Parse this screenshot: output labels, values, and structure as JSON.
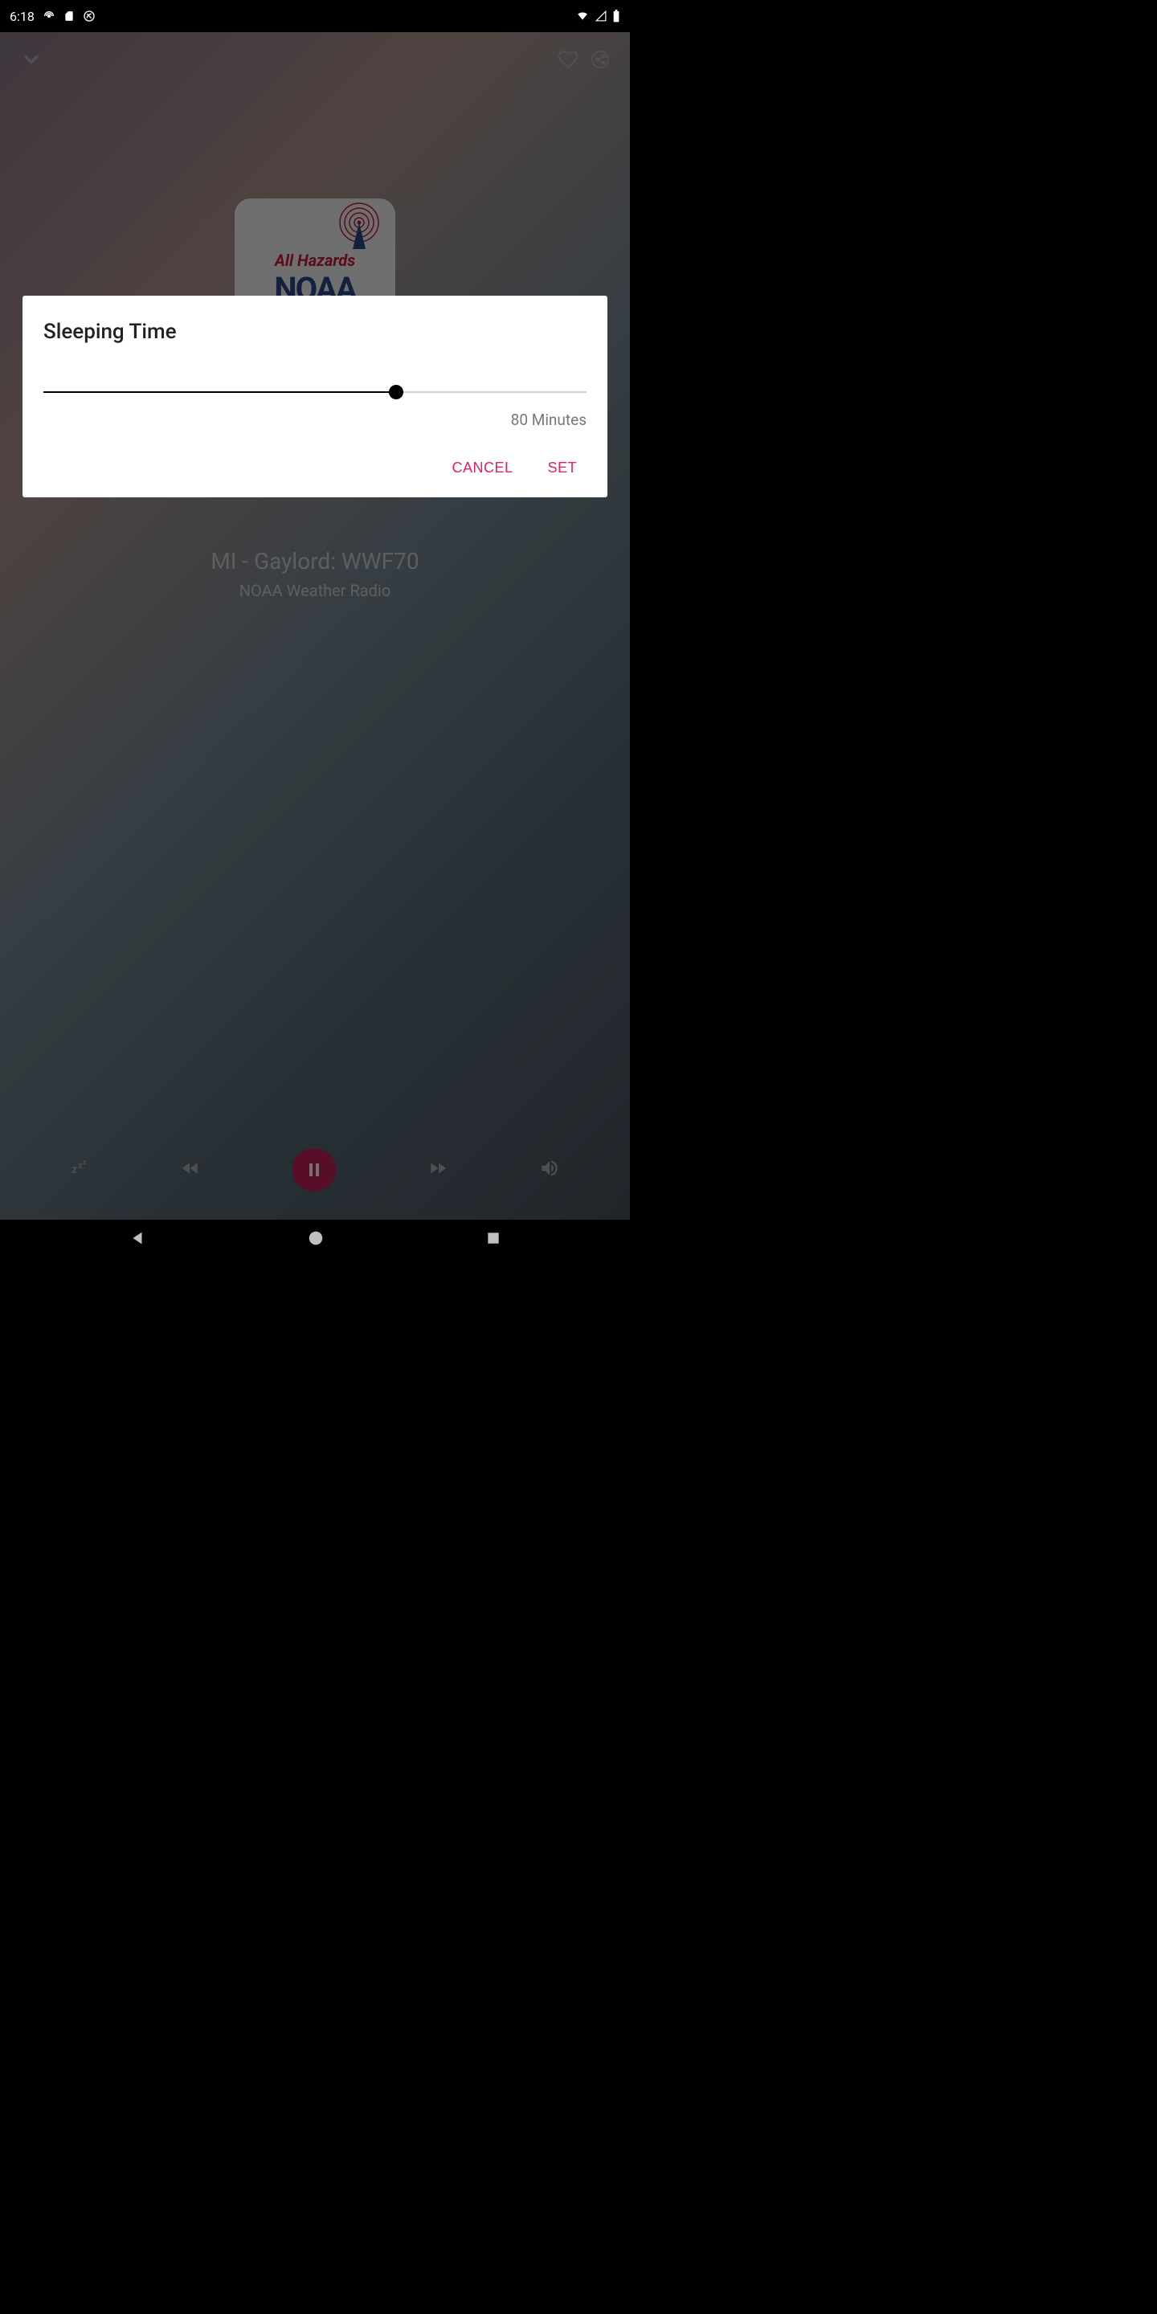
{
  "statusBar": {
    "time": "6:18"
  },
  "player": {
    "stationTitle": "MI - Gaylord: WWF70",
    "stationSubtitle": "NOAA Weather Radio",
    "albumText1": "All Hazards",
    "albumText2": "NOAA"
  },
  "dialog": {
    "title": "Sleeping Time",
    "sliderValue": 80,
    "sliderLabel": "80 Minutes",
    "cancelLabel": "CANCEL",
    "setLabel": "SET"
  }
}
